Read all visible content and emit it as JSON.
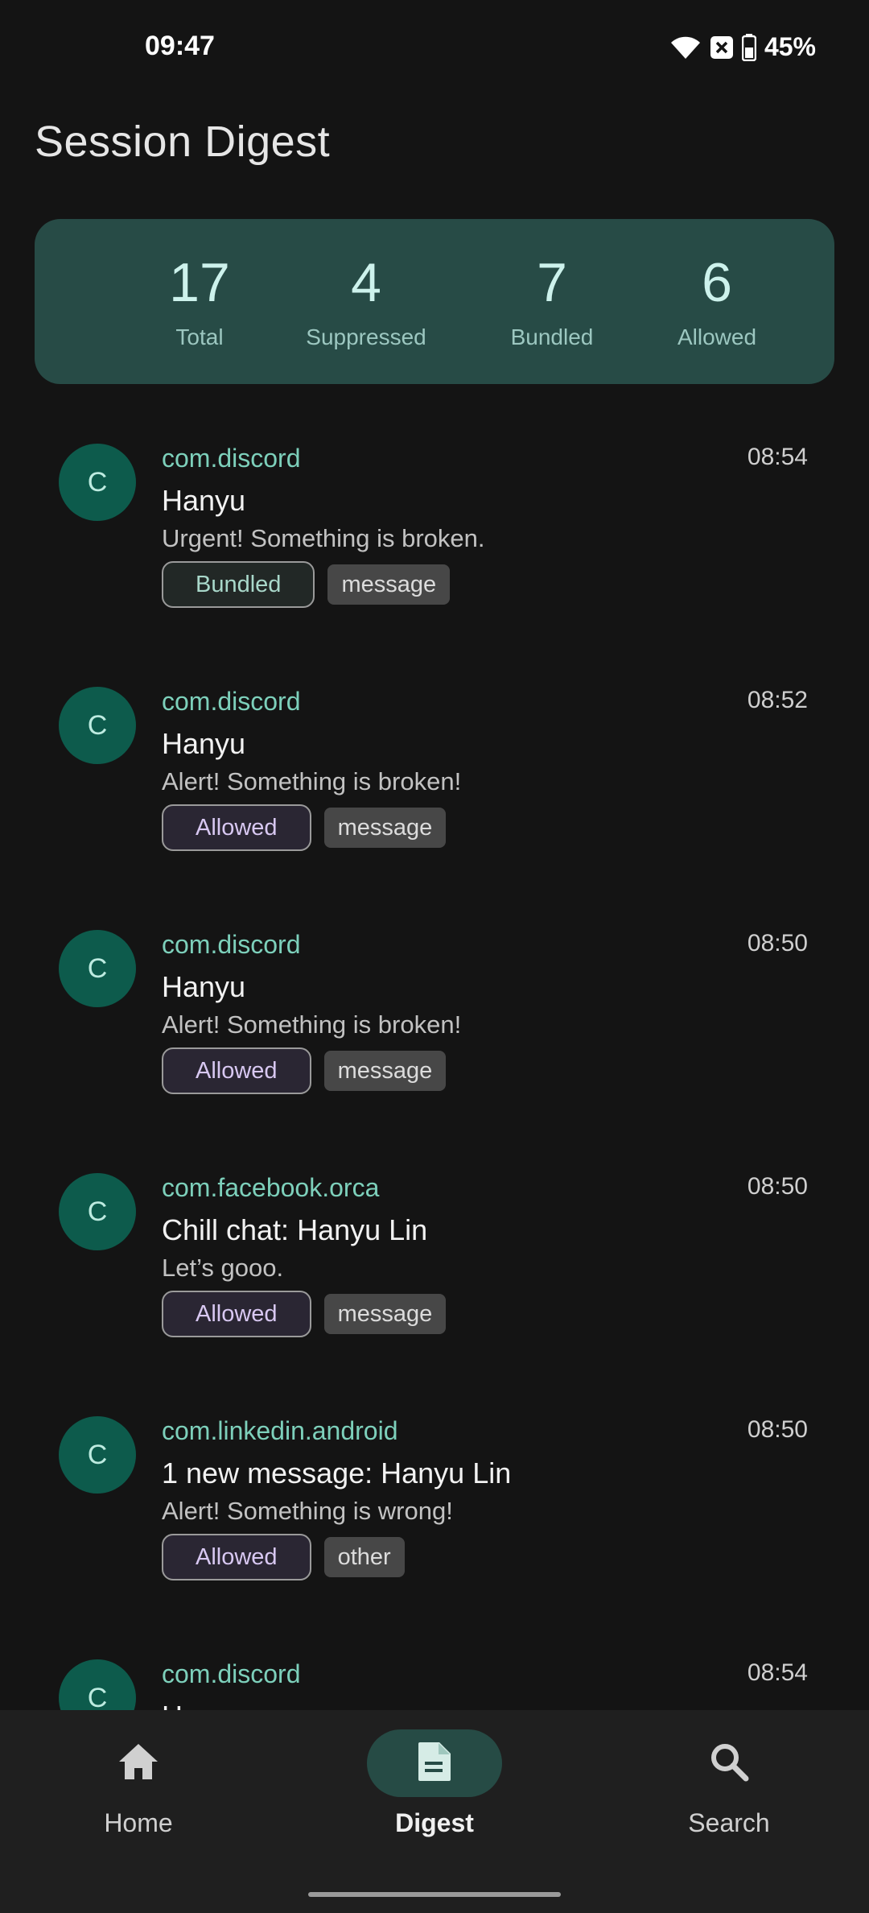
{
  "status_bar": {
    "time": "09:47",
    "battery": "45%",
    "icons": [
      "wifi-icon",
      "notification-x-icon",
      "battery-icon"
    ]
  },
  "title": "Session Digest",
  "stats": [
    {
      "value": "17",
      "label": "Total"
    },
    {
      "value": "4",
      "label": "Suppressed"
    },
    {
      "value": "7",
      "label": "Bundled"
    },
    {
      "value": "6",
      "label": "Allowed"
    }
  ],
  "notifications": [
    {
      "initial": "C",
      "package": "com.discord",
      "time": "08:54",
      "title": "Hanyu",
      "body": "Urgent! Something is broken.",
      "status": "Bundled",
      "category": "message"
    },
    {
      "initial": "C",
      "package": "com.discord",
      "time": "08:52",
      "title": "Hanyu",
      "body": "Alert! Something is broken!",
      "status": "Allowed",
      "category": "message"
    },
    {
      "initial": "C",
      "package": "com.discord",
      "time": "08:50",
      "title": "Hanyu",
      "body": "Alert! Something is broken!",
      "status": "Allowed",
      "category": "message"
    },
    {
      "initial": "C",
      "package": "com.facebook.orca",
      "time": "08:50",
      "title": "Chill chat: Hanyu Lin",
      "body": "Let’s gooo.",
      "status": "Allowed",
      "category": "message"
    },
    {
      "initial": "C",
      "package": "com.linkedin.android",
      "time": "08:50",
      "title": "1 new message: Hanyu Lin",
      "body": "Alert! Something is wrong!",
      "status": "Allowed",
      "category": "other"
    },
    {
      "initial": "C",
      "package": "com.discord",
      "time": "08:54",
      "title": "Hanyu",
      "body": "",
      "status": "",
      "category": ""
    }
  ],
  "nav": {
    "items": [
      {
        "label": "Home",
        "icon": "home-icon"
      },
      {
        "label": "Digest",
        "icon": "digest-icon",
        "active": true
      },
      {
        "label": "Search",
        "icon": "search-icon"
      }
    ]
  },
  "colors": {
    "background": "#141414",
    "accent_card": "#274b46",
    "avatar": "#0d5b4c",
    "package_text": "#7dd0bb"
  }
}
